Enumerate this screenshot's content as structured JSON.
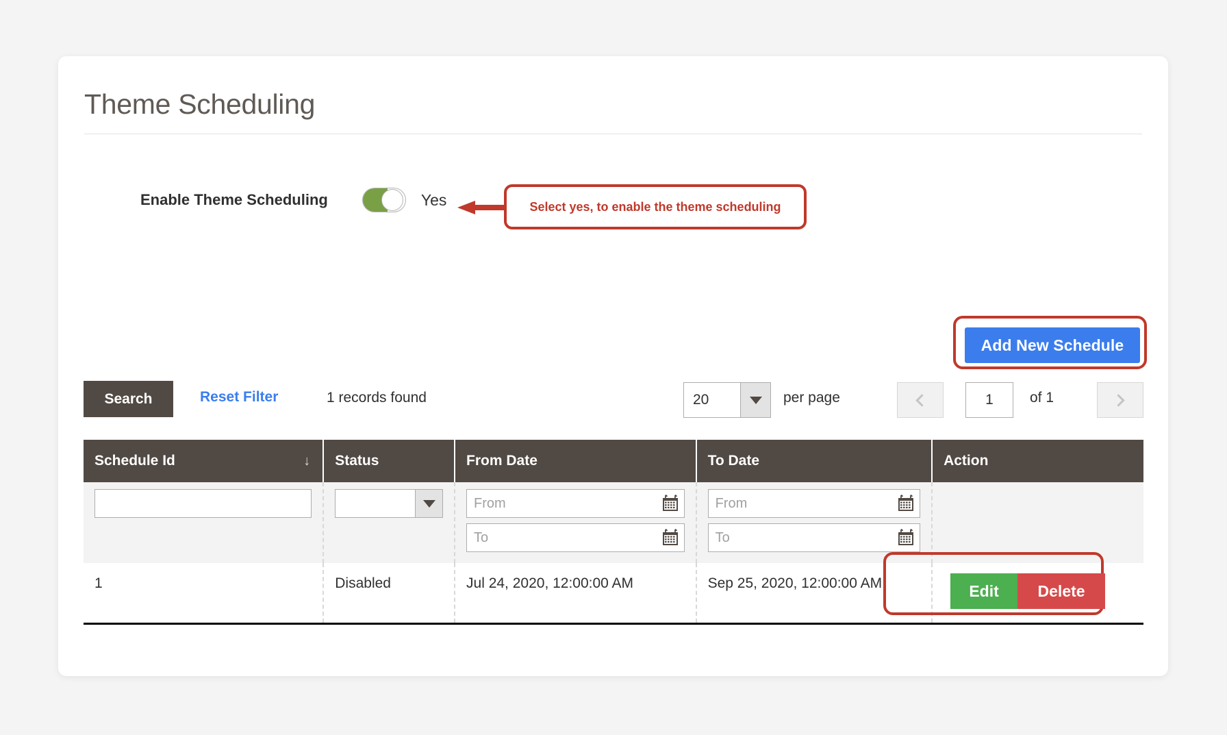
{
  "page": {
    "title": "Theme Scheduling"
  },
  "settings": {
    "enable_label": "Enable Theme Scheduling",
    "toggle_state_text": "Yes",
    "toggle_on": true
  },
  "annotations": [
    {
      "id": "enable-toggle-callout",
      "text": "Select yes, to enable the theme scheduling",
      "color": "#c0392b"
    },
    {
      "id": "add-new-schedule-highlight",
      "color": "#c0392b"
    },
    {
      "id": "row-action-highlight",
      "color": "#c0392b"
    }
  ],
  "toolbar": {
    "add_button_label": "Add New Schedule",
    "add_button_color": "#3b7ded",
    "search_label": "Search",
    "reset_filter_label": "Reset Filter",
    "records_found": "1 records found",
    "per_page_value": "20",
    "per_page_label": "per page",
    "page_value": "1",
    "page_of": "of 1",
    "prev_icon": "chevron-left-icon",
    "next_icon": "chevron-right-icon",
    "dropdown_icon": "caret-down-icon"
  },
  "grid": {
    "columns": [
      {
        "label": "Schedule Id",
        "sorted": true,
        "sort_icon": "arrow-down-icon"
      },
      {
        "label": "Status",
        "sorted": false
      },
      {
        "label": "From Date",
        "sorted": false
      },
      {
        "label": "To Date",
        "sorted": false
      },
      {
        "label": "Action",
        "sorted": false
      }
    ],
    "filters": {
      "schedule_id_value": "",
      "status_value": "",
      "from_date_from_placeholder": "From",
      "from_date_to_placeholder": "To",
      "to_date_from_placeholder": "From",
      "to_date_to_placeholder": "To",
      "calendar_icon": "calendar-icon"
    },
    "rows": [
      {
        "schedule_id": "1",
        "status": "Disabled",
        "from_date": "Jul 24, 2020, 12:00:00 AM",
        "to_date": "Sep 25, 2020, 12:00:00 AM",
        "edit_label": "Edit",
        "delete_label": "Delete",
        "edit_color": "#4caf50",
        "delete_color": "#d6494a"
      }
    ]
  }
}
